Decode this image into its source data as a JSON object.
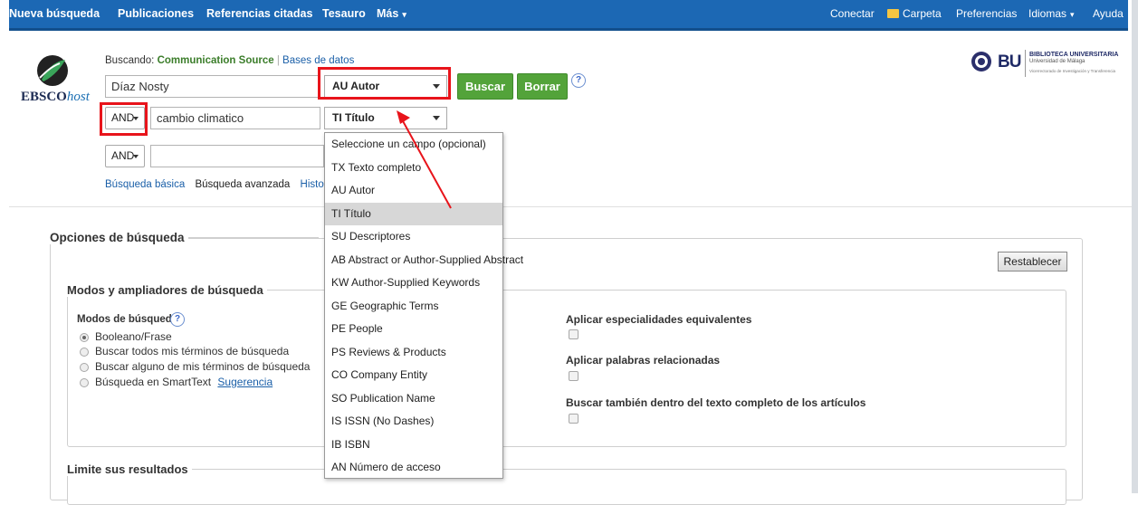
{
  "nav": {
    "left": [
      "Nueva búsqueda",
      "Publicaciones",
      "Referencias citadas",
      "Tesauro",
      "Más"
    ],
    "right": [
      "Conectar",
      "Carpeta",
      "Preferencias",
      "Idiomas",
      "Ayuda"
    ]
  },
  "brand": {
    "name": "EBSCO",
    "suffix": "host"
  },
  "library": {
    "bu": "BU",
    "line1": "BIBLIOTECA UNIVERSITARIA",
    "line2": "Universidad de Málaga",
    "line3": "Vicerrectorado de Investigación y Transferencia"
  },
  "search": {
    "searching_label": "Buscando:",
    "database": "Communication Source",
    "databases_link": "Bases de datos",
    "rows": [
      {
        "bool": "",
        "term": "Díaz Nosty",
        "field": "AU Autor"
      },
      {
        "bool": "AND",
        "term": "cambio climatico",
        "field": "TI Título"
      },
      {
        "bool": "AND",
        "term": "",
        "field": ""
      }
    ],
    "search_button": "Buscar",
    "clear_button": "Borrar",
    "help": "?",
    "links": [
      "Búsqueda básica",
      "Búsqueda avanzada",
      "Historial"
    ]
  },
  "dropdown": {
    "options": [
      "Seleccione un campo (opcional)",
      "TX Texto completo",
      "AU Autor",
      "TI Título",
      "SU Descriptores",
      "AB Abstract or Author-Supplied Abstract",
      "KW Author-Supplied Keywords",
      "GE Geographic Terms",
      "PE People",
      "PS Reviews & Products",
      "CO Company Entity",
      "SO Publication Name",
      "IS ISSN (No Dashes)",
      "IB ISBN",
      "AN Número de acceso"
    ],
    "selected": "TI Título"
  },
  "options": {
    "title": "Opciones de búsqueda",
    "reset_button": "Restablecer",
    "modes_title": "Modos y ampliadores de búsqueda",
    "modes_label": "Modos de búsqueda",
    "modes": [
      "Booleano/Frase",
      "Buscar todos mis términos de búsqueda",
      "Buscar alguno de mis términos de búsqueda",
      "Búsqueda en SmartText"
    ],
    "suggestion_link": "Sugerencia",
    "expanders": [
      "Aplicar especialidades equivalentes",
      "Aplicar palabras relacionadas",
      "Buscar también dentro del texto completo de los artículos"
    ],
    "limits_title": "Limite sus resultados"
  },
  "colors": {
    "nav": "#1c68b4",
    "button": "#53a33a",
    "highlight": "#e8141b"
  }
}
